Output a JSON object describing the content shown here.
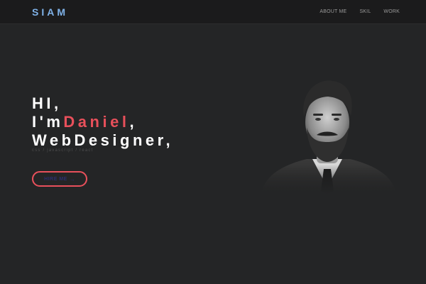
{
  "brand": {
    "logo": "SIAM"
  },
  "nav": {
    "items": [
      "ABOUT ME",
      "SKIL",
      "WORK"
    ]
  },
  "hero": {
    "line1": "HI,",
    "line2_prefix": "I'm",
    "line2_name": "Daniel",
    "line2_suffix": ",",
    "line3": "WebDesigner,",
    "skills": "css  /  javascript  /  react",
    "cta_label": "HIRE ME",
    "cta_arrow": "→"
  },
  "colors": {
    "accent": "#e8505b",
    "logo": "#7fb2e8",
    "background": "#242526"
  },
  "icons": {
    "cta": "arrow-right-icon",
    "portrait": "person-portrait-image"
  }
}
